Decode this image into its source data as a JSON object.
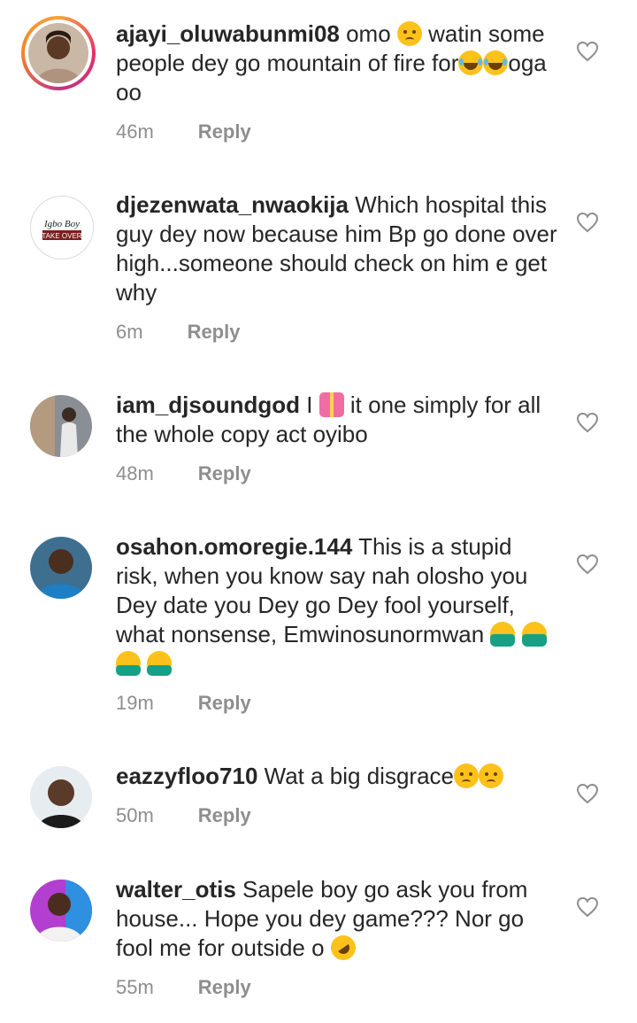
{
  "comments": [
    {
      "username": "ajayi_oluwabunmi08",
      "text_a": " omo ",
      "text_b": " watin some people dey go mountain of fire for",
      "text_c": "oga oo",
      "time": "46m",
      "reply": "Reply"
    },
    {
      "username": "djezenwata_nwaokija",
      "text_a": " Which hospital this guy dey now because him Bp go done over high...someone should check on him e get why",
      "time": "6m",
      "reply": "Reply"
    },
    {
      "username": "iam_djsoundgod",
      "text_a": " I ",
      "text_b": " it one simply for all the whole copy act  oyibo",
      "time": "48m",
      "reply": "Reply"
    },
    {
      "username": "osahon.omoregie.144",
      "text_a": " This is a stupid risk, when you know say nah olosho you Dey date you Dey go Dey fool yourself, what nonsense, Emwinosunormwan ",
      "time": "19m",
      "reply": "Reply"
    },
    {
      "username": "eazzyfloo710",
      "text_a": " Wat a big disgrace",
      "time": "50m",
      "reply": "Reply"
    },
    {
      "username": "walter_otis",
      "text_a": " Sapele boy go ask you from house... Hope you dey game??? Nor go fool me for outside o ",
      "time": "55m",
      "reply": "Reply"
    }
  ],
  "avatar_logo": {
    "line1": "Igbo Boy",
    "line2": "TAKE OVER"
  },
  "emoji_names": [
    "crying-face",
    "face-with-tears-of-joy",
    "heart-with-ribbon",
    "person-facepalming",
    "person-getting-massage",
    "rolling-on-floor-laughing"
  ],
  "colors": {
    "text": "#262626",
    "muted": "#8e8e8e",
    "story_ring": "#e1306c"
  }
}
